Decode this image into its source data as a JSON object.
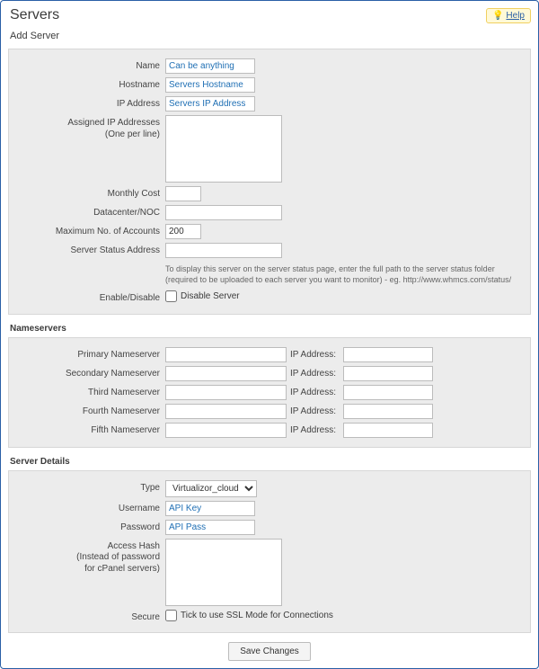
{
  "page": {
    "title": "Servers",
    "subtitle": "Add Server"
  },
  "help": {
    "label": "Help"
  },
  "main": {
    "name": {
      "label": "Name",
      "value": "Can be anything"
    },
    "hostname": {
      "label": "Hostname",
      "value": "Servers Hostname"
    },
    "ip": {
      "label": "IP Address",
      "value": "Servers IP Address"
    },
    "assigned_ips": {
      "label": "Assigned IP Addresses\n(One per line)",
      "value": ""
    },
    "monthly": {
      "label": "Monthly Cost",
      "value": ""
    },
    "dcnoc": {
      "label": "Datacenter/NOC",
      "value": ""
    },
    "maxacc": {
      "label": "Maximum No. of Accounts",
      "value": "200"
    },
    "status_addr": {
      "label": "Server Status Address",
      "value": "",
      "hint": "To display this server on the server status page, enter the full path to the server status folder (required to be uploaded to each server you want to monitor) - eg. http://www.whmcs.com/status/"
    },
    "enable": {
      "label": "Enable/Disable",
      "checkbox_label": "Disable Server",
      "checked": false
    }
  },
  "nameservers_heading": "Nameservers",
  "ns_ip_label": "IP Address:",
  "nameservers": [
    {
      "label": "Primary Nameserver",
      "name": "",
      "ip": ""
    },
    {
      "label": "Secondary Nameserver",
      "name": "",
      "ip": ""
    },
    {
      "label": "Third Nameserver",
      "name": "",
      "ip": ""
    },
    {
      "label": "Fourth Nameserver",
      "name": "",
      "ip": ""
    },
    {
      "label": "Fifth Nameserver",
      "name": "",
      "ip": ""
    }
  ],
  "server_details_heading": "Server Details",
  "details": {
    "type": {
      "label": "Type",
      "value": "Virtualizor_cloud"
    },
    "username": {
      "label": "Username",
      "value": "API Key"
    },
    "password": {
      "label": "Password",
      "value": "API Pass"
    },
    "hash": {
      "label": "Access Hash\n(Instead of password\nfor cPanel servers)",
      "value": ""
    },
    "secure": {
      "label": "Secure",
      "checkbox_label": "Tick to use SSL Mode for Connections",
      "checked": false
    }
  },
  "save_label": "Save Changes"
}
